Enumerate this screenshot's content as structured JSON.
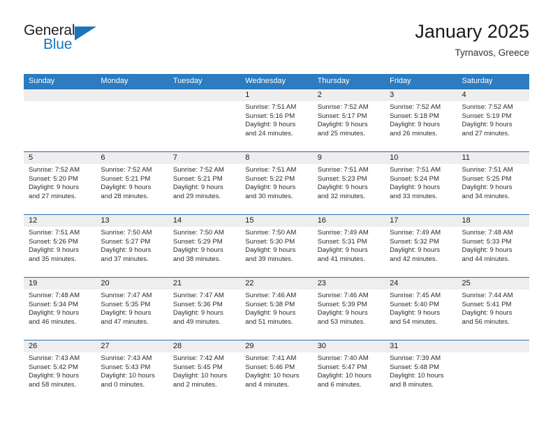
{
  "brand": {
    "name_top": "General",
    "name_bottom": "Blue",
    "triangle_icon": "triangle-logo-icon",
    "accent_color": "#1b75bb"
  },
  "header": {
    "title": "January 2025",
    "subtitle": "Tyrnavos, Greece"
  },
  "theme": {
    "header_bg": "#2b7cc0",
    "row_rule": "#2c69a8",
    "day_band": "#eeeeee",
    "text": "#2b2b2b"
  },
  "calendar": {
    "weekday_headers": [
      "Sunday",
      "Monday",
      "Tuesday",
      "Wednesday",
      "Thursday",
      "Friday",
      "Saturday"
    ],
    "labels": {
      "sunrise": "Sunrise:",
      "sunset": "Sunset:",
      "daylight": "Daylight:"
    },
    "weeks": [
      [
        {
          "day": "",
          "sunrise": "",
          "sunset": "",
          "daylight_line1": "",
          "daylight_line2": ""
        },
        {
          "day": "",
          "sunrise": "",
          "sunset": "",
          "daylight_line1": "",
          "daylight_line2": ""
        },
        {
          "day": "",
          "sunrise": "",
          "sunset": "",
          "daylight_line1": "",
          "daylight_line2": ""
        },
        {
          "day": "1",
          "sunrise": "Sunrise: 7:51 AM",
          "sunset": "Sunset: 5:16 PM",
          "daylight_line1": "Daylight: 9 hours",
          "daylight_line2": "and 24 minutes."
        },
        {
          "day": "2",
          "sunrise": "Sunrise: 7:52 AM",
          "sunset": "Sunset: 5:17 PM",
          "daylight_line1": "Daylight: 9 hours",
          "daylight_line2": "and 25 minutes."
        },
        {
          "day": "3",
          "sunrise": "Sunrise: 7:52 AM",
          "sunset": "Sunset: 5:18 PM",
          "daylight_line1": "Daylight: 9 hours",
          "daylight_line2": "and 26 minutes."
        },
        {
          "day": "4",
          "sunrise": "Sunrise: 7:52 AM",
          "sunset": "Sunset: 5:19 PM",
          "daylight_line1": "Daylight: 9 hours",
          "daylight_line2": "and 27 minutes."
        }
      ],
      [
        {
          "day": "5",
          "sunrise": "Sunrise: 7:52 AM",
          "sunset": "Sunset: 5:20 PM",
          "daylight_line1": "Daylight: 9 hours",
          "daylight_line2": "and 27 minutes."
        },
        {
          "day": "6",
          "sunrise": "Sunrise: 7:52 AM",
          "sunset": "Sunset: 5:21 PM",
          "daylight_line1": "Daylight: 9 hours",
          "daylight_line2": "and 28 minutes."
        },
        {
          "day": "7",
          "sunrise": "Sunrise: 7:52 AM",
          "sunset": "Sunset: 5:21 PM",
          "daylight_line1": "Daylight: 9 hours",
          "daylight_line2": "and 29 minutes."
        },
        {
          "day": "8",
          "sunrise": "Sunrise: 7:51 AM",
          "sunset": "Sunset: 5:22 PM",
          "daylight_line1": "Daylight: 9 hours",
          "daylight_line2": "and 30 minutes."
        },
        {
          "day": "9",
          "sunrise": "Sunrise: 7:51 AM",
          "sunset": "Sunset: 5:23 PM",
          "daylight_line1": "Daylight: 9 hours",
          "daylight_line2": "and 32 minutes."
        },
        {
          "day": "10",
          "sunrise": "Sunrise: 7:51 AM",
          "sunset": "Sunset: 5:24 PM",
          "daylight_line1": "Daylight: 9 hours",
          "daylight_line2": "and 33 minutes."
        },
        {
          "day": "11",
          "sunrise": "Sunrise: 7:51 AM",
          "sunset": "Sunset: 5:25 PM",
          "daylight_line1": "Daylight: 9 hours",
          "daylight_line2": "and 34 minutes."
        }
      ],
      [
        {
          "day": "12",
          "sunrise": "Sunrise: 7:51 AM",
          "sunset": "Sunset: 5:26 PM",
          "daylight_line1": "Daylight: 9 hours",
          "daylight_line2": "and 35 minutes."
        },
        {
          "day": "13",
          "sunrise": "Sunrise: 7:50 AM",
          "sunset": "Sunset: 5:27 PM",
          "daylight_line1": "Daylight: 9 hours",
          "daylight_line2": "and 37 minutes."
        },
        {
          "day": "14",
          "sunrise": "Sunrise: 7:50 AM",
          "sunset": "Sunset: 5:29 PM",
          "daylight_line1": "Daylight: 9 hours",
          "daylight_line2": "and 38 minutes."
        },
        {
          "day": "15",
          "sunrise": "Sunrise: 7:50 AM",
          "sunset": "Sunset: 5:30 PM",
          "daylight_line1": "Daylight: 9 hours",
          "daylight_line2": "and 39 minutes."
        },
        {
          "day": "16",
          "sunrise": "Sunrise: 7:49 AM",
          "sunset": "Sunset: 5:31 PM",
          "daylight_line1": "Daylight: 9 hours",
          "daylight_line2": "and 41 minutes."
        },
        {
          "day": "17",
          "sunrise": "Sunrise: 7:49 AM",
          "sunset": "Sunset: 5:32 PM",
          "daylight_line1": "Daylight: 9 hours",
          "daylight_line2": "and 42 minutes."
        },
        {
          "day": "18",
          "sunrise": "Sunrise: 7:48 AM",
          "sunset": "Sunset: 5:33 PM",
          "daylight_line1": "Daylight: 9 hours",
          "daylight_line2": "and 44 minutes."
        }
      ],
      [
        {
          "day": "19",
          "sunrise": "Sunrise: 7:48 AM",
          "sunset": "Sunset: 5:34 PM",
          "daylight_line1": "Daylight: 9 hours",
          "daylight_line2": "and 46 minutes."
        },
        {
          "day": "20",
          "sunrise": "Sunrise: 7:47 AM",
          "sunset": "Sunset: 5:35 PM",
          "daylight_line1": "Daylight: 9 hours",
          "daylight_line2": "and 47 minutes."
        },
        {
          "day": "21",
          "sunrise": "Sunrise: 7:47 AM",
          "sunset": "Sunset: 5:36 PM",
          "daylight_line1": "Daylight: 9 hours",
          "daylight_line2": "and 49 minutes."
        },
        {
          "day": "22",
          "sunrise": "Sunrise: 7:46 AM",
          "sunset": "Sunset: 5:38 PM",
          "daylight_line1": "Daylight: 9 hours",
          "daylight_line2": "and 51 minutes."
        },
        {
          "day": "23",
          "sunrise": "Sunrise: 7:46 AM",
          "sunset": "Sunset: 5:39 PM",
          "daylight_line1": "Daylight: 9 hours",
          "daylight_line2": "and 53 minutes."
        },
        {
          "day": "24",
          "sunrise": "Sunrise: 7:45 AM",
          "sunset": "Sunset: 5:40 PM",
          "daylight_line1": "Daylight: 9 hours",
          "daylight_line2": "and 54 minutes."
        },
        {
          "day": "25",
          "sunrise": "Sunrise: 7:44 AM",
          "sunset": "Sunset: 5:41 PM",
          "daylight_line1": "Daylight: 9 hours",
          "daylight_line2": "and 56 minutes."
        }
      ],
      [
        {
          "day": "26",
          "sunrise": "Sunrise: 7:43 AM",
          "sunset": "Sunset: 5:42 PM",
          "daylight_line1": "Daylight: 9 hours",
          "daylight_line2": "and 58 minutes."
        },
        {
          "day": "27",
          "sunrise": "Sunrise: 7:43 AM",
          "sunset": "Sunset: 5:43 PM",
          "daylight_line1": "Daylight: 10 hours",
          "daylight_line2": "and 0 minutes."
        },
        {
          "day": "28",
          "sunrise": "Sunrise: 7:42 AM",
          "sunset": "Sunset: 5:45 PM",
          "daylight_line1": "Daylight: 10 hours",
          "daylight_line2": "and 2 minutes."
        },
        {
          "day": "29",
          "sunrise": "Sunrise: 7:41 AM",
          "sunset": "Sunset: 5:46 PM",
          "daylight_line1": "Daylight: 10 hours",
          "daylight_line2": "and 4 minutes."
        },
        {
          "day": "30",
          "sunrise": "Sunrise: 7:40 AM",
          "sunset": "Sunset: 5:47 PM",
          "daylight_line1": "Daylight: 10 hours",
          "daylight_line2": "and 6 minutes."
        },
        {
          "day": "31",
          "sunrise": "Sunrise: 7:39 AM",
          "sunset": "Sunset: 5:48 PM",
          "daylight_line1": "Daylight: 10 hours",
          "daylight_line2": "and 8 minutes."
        },
        {
          "day": "",
          "sunrise": "",
          "sunset": "",
          "daylight_line1": "",
          "daylight_line2": ""
        }
      ]
    ]
  }
}
